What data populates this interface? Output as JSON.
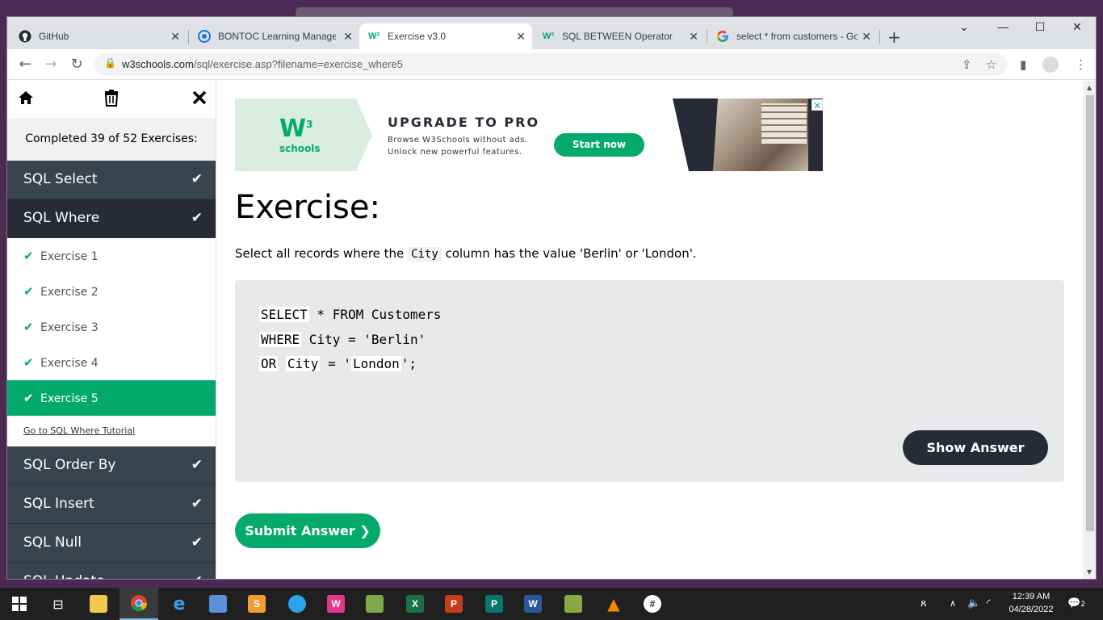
{
  "browser": {
    "tabs": [
      {
        "label": "GitHub",
        "icon": "github-icon"
      },
      {
        "label": "BONTOC Learning Managem",
        "icon": "moodle-icon"
      },
      {
        "label": "Exercise v3.0",
        "icon": "w3schools-icon",
        "active": true
      },
      {
        "label": "SQL BETWEEN Operator",
        "icon": "w3schools-icon"
      },
      {
        "label": "select * from customers - Go",
        "icon": "google-icon"
      }
    ],
    "url_domain": "w3schools.com",
    "url_path": "/sql/exercise.asp?filename=exercise_where5"
  },
  "sidebar": {
    "progress": "Completed 39 of 52 Exercises:",
    "categories_before": [
      {
        "label": "SQL Select"
      }
    ],
    "open_category": {
      "label": "SQL Where"
    },
    "exercises": [
      {
        "label": "Exercise 1"
      },
      {
        "label": "Exercise 2"
      },
      {
        "label": "Exercise 3"
      },
      {
        "label": "Exercise 4"
      },
      {
        "label": "Exercise 5"
      }
    ],
    "tutorial_link": "Go to SQL Where Tutorial",
    "categories_after": [
      {
        "label": "SQL Order By"
      },
      {
        "label": "SQL Insert"
      },
      {
        "label": "SQL Null"
      },
      {
        "label": "SQL Update"
      }
    ]
  },
  "ad": {
    "logo_text": "W",
    "logo_sup": "3",
    "logo_sub": "schools",
    "headline": "UPGRADE TO PRO",
    "line1": "Browse W3Schools without ads.",
    "line2": "Unlock new powerful features.",
    "cta": "Start now"
  },
  "main": {
    "title": "Exercise:",
    "desc_before": "Select all records where the",
    "desc_code": "City",
    "desc_after": "column has the value 'Berlin' or 'London'.",
    "code": {
      "l1_field": "SELECT",
      "l1_rest": " * FROM Customers",
      "l2_field": "WHERE",
      "l2_rest": " City = 'Berlin'",
      "l3_field1": "OR",
      "l3_field2": "City",
      "l3_mid": " = '",
      "l3_field3": "London",
      "l3_end": "';"
    },
    "show_answer": "Show Answer",
    "submit": "Submit Answer ❯"
  },
  "taskbar": {
    "time": "12:39 AM",
    "date": "04/28/2022",
    "notifications": "2"
  },
  "colors": {
    "accent": "#04AA6D",
    "dark": "#282A35",
    "sidebar_cat": "#38444d"
  }
}
